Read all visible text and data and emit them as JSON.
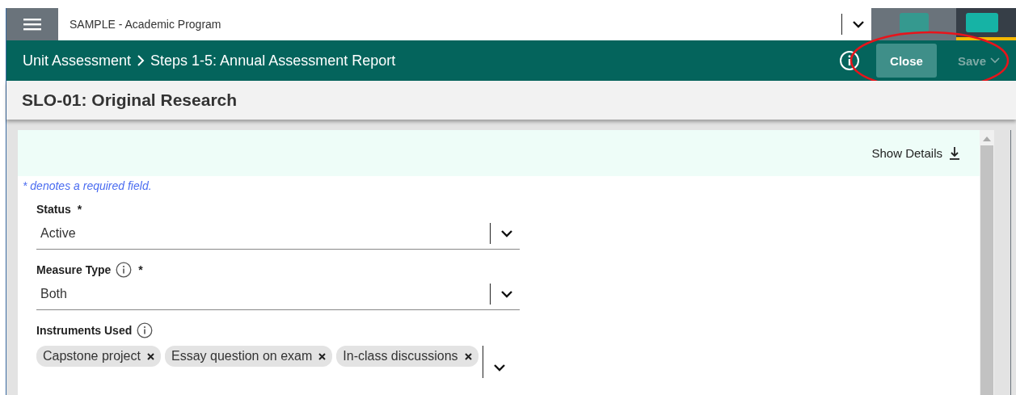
{
  "program_select": {
    "value": "SAMPLE - Academic Program"
  },
  "breadcrumb": [
    {
      "label": "Unit Assessment"
    },
    {
      "label": "Steps 1-5: Annual Assessment Report"
    }
  ],
  "actions": [
    {
      "kind": "button",
      "label": "Close",
      "disabled": false
    },
    {
      "kind": "dropdown",
      "label": "Save",
      "disabled": true
    }
  ],
  "page_title": "SLO-01: Original Research",
  "details_toggle": "Show Details",
  "required_note": "* denotes a required field.",
  "fields": [
    {
      "label": "Status",
      "required_mark": "*",
      "info": false,
      "kind": "select",
      "value": "Active"
    },
    {
      "label": "Measure Type",
      "required_mark": "*",
      "info": true,
      "kind": "select",
      "value": "Both"
    },
    {
      "label": "Instruments Used",
      "info": true,
      "kind": "multiselect",
      "chips": [
        "Capstone project",
        "Essay question on exam",
        "In-class discussions"
      ]
    }
  ],
  "annotations": [
    {
      "kind": "ellipse",
      "color": "#e8141b"
    }
  ]
}
